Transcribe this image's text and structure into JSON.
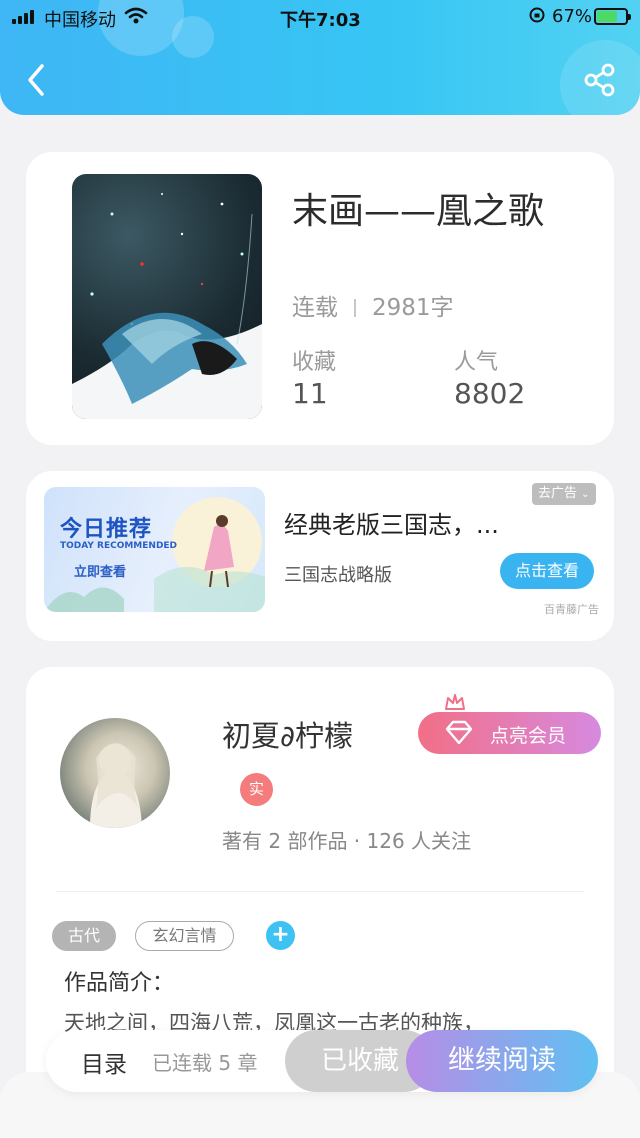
{
  "status_bar": {
    "carrier": "中国移动",
    "time": "下午7:03",
    "battery_pct": "67%",
    "battery_level": 0.67
  },
  "nav": {
    "back_icon": "chevron-left-icon",
    "share_icon": "share-icon"
  },
  "book": {
    "title": "末画——凰之歌",
    "status": "连载",
    "word_count": "2981字",
    "favorites_label": "收藏",
    "favorites_value": "11",
    "popularity_label": "人气",
    "popularity_value": "8802"
  },
  "ad": {
    "image_title": "今日推荐",
    "image_subtitle": "TODAY RECOMMENDED",
    "image_cta": "立即查看",
    "title": "经典老版三国志，...",
    "subtitle": "三国志战略版",
    "button": "点击查看",
    "remove_label": "去广告",
    "source": "百青藤广告"
  },
  "author": {
    "name": "初夏∂柠檬",
    "vip_button": "点亮会员",
    "verified_badge": "实",
    "stats": "著有 2 部作品 · 126 人关注",
    "tags": [
      "古代",
      "玄幻言情"
    ],
    "intro_label": "作品简介：",
    "intro_text": "天地之间，四海八荒，凤凰这一古老的种族，"
  },
  "bottom_bar": {
    "toc": "目录",
    "chapters": "已连载 5 章",
    "favorited": "已收藏",
    "continue_reading": "继续阅读"
  },
  "colors": {
    "header_blue": "#3fb6f5",
    "accent_blue": "#39b4f0",
    "vip_pink": "#f26f86",
    "vip_purple": "#d68ae0"
  }
}
